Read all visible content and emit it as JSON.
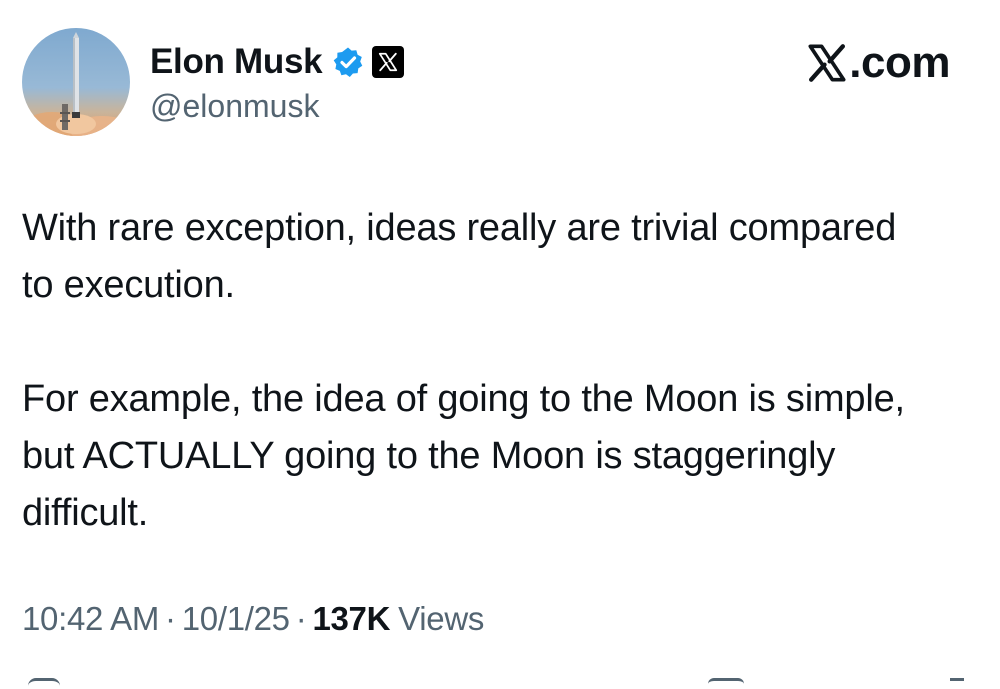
{
  "author": {
    "display_name": "Elon Musk",
    "handle": "@elonmusk",
    "avatar_icon": "rocket-launch-avatar",
    "verified_icon": "verified-badge-icon",
    "affiliation_icon": "x-logo-icon"
  },
  "site": {
    "domain_suffix": ".com",
    "logo_icon": "x-logo-icon"
  },
  "post": {
    "paragraphs": [
      "With rare exception, ideas really are trivial compared to execution.",
      "For example, the idea of going to the Moon is simple, but ACTUALLY going to the Moon is staggeringly difficult."
    ]
  },
  "meta": {
    "time": "10:42 AM",
    "separator": "·",
    "date": "10/1/25",
    "views_count": "137K",
    "views_label": "Views"
  },
  "colors": {
    "text_primary": "#0f1419",
    "text_secondary": "#536471",
    "verified_blue": "#1d9bf0",
    "background": "#ffffff"
  }
}
